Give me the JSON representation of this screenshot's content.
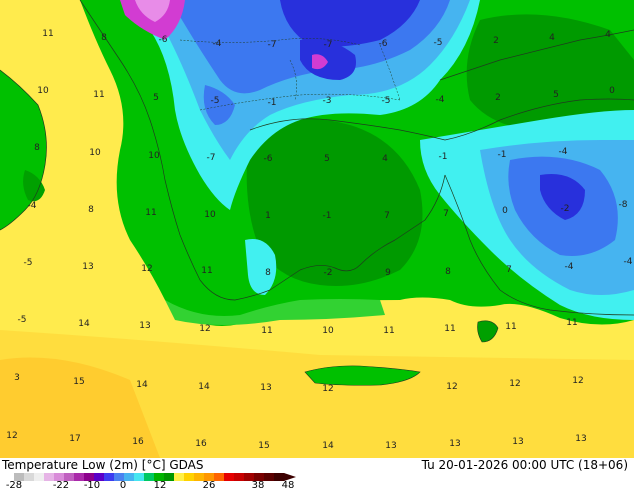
{
  "title": "Temperature Low (2m) [°C] GDAS",
  "valid_time": "Tu 20-01-2026 00:00 UTC (18+06)",
  "colorbar": {
    "ticks": [
      "-28",
      "-22",
      "-10",
      "0",
      "12",
      "26",
      "38",
      "48"
    ],
    "colors": [
      "#bcbcbc",
      "#d9d9d9",
      "#efefef",
      "#e6b4e6",
      "#d98cd9",
      "#c060c0",
      "#aa2aaa",
      "#8c008c",
      "#5a00c8",
      "#3c3cf0",
      "#4a82f0",
      "#46b4f0",
      "#46e6f0",
      "#00c864",
      "#00b400",
      "#009600",
      "#fff046",
      "#ffd200",
      "#ffb400",
      "#ff9600",
      "#ff6400",
      "#e60000",
      "#c80000",
      "#a00000",
      "#780000",
      "#5a0000",
      "#3c0000"
    ]
  },
  "colors": {
    "ocean_warm": "#ffeb4d",
    "ocean_warmer": "#ffd233",
    "green_dark": "#00a000",
    "green_mid": "#00c000",
    "green_light": "#32d232",
    "cyan": "#41f0f0",
    "sky": "#46b4f0",
    "blue": "#3c78f0",
    "dark_blue": "#2830dc",
    "magenta": "#d23cd2",
    "coast": "#1e3c1e"
  },
  "labels": [
    {
      "v": "11"
    },
    {
      "v": "8"
    },
    {
      "v": "-6"
    },
    {
      "v": "-4"
    },
    {
      "v": "-7"
    },
    {
      "v": "-7"
    },
    {
      "v": "-6"
    },
    {
      "v": "-5"
    },
    {
      "v": "2"
    },
    {
      "v": "4"
    },
    {
      "v": "4"
    },
    {
      "v": "10"
    },
    {
      "v": "11"
    },
    {
      "v": "5"
    },
    {
      "v": "-5"
    },
    {
      "v": "-1"
    },
    {
      "v": "-3"
    },
    {
      "v": "-5"
    },
    {
      "v": "-4"
    },
    {
      "v": "2"
    },
    {
      "v": "5"
    },
    {
      "v": "0"
    },
    {
      "v": "8"
    },
    {
      "v": "10"
    },
    {
      "v": "10"
    },
    {
      "v": "-7"
    },
    {
      "v": "-6"
    },
    {
      "v": "5"
    },
    {
      "v": "4"
    },
    {
      "v": "-1"
    },
    {
      "v": "-1"
    },
    {
      "v": "-4"
    },
    {
      "v": "-4"
    },
    {
      "v": "8"
    },
    {
      "v": "11"
    },
    {
      "v": "10"
    },
    {
      "v": "1"
    },
    {
      "v": "-1"
    },
    {
      "v": "7"
    },
    {
      "v": "7"
    },
    {
      "v": "0"
    },
    {
      "v": "-2"
    },
    {
      "v": "-8"
    },
    {
      "v": "-5"
    },
    {
      "v": "13"
    },
    {
      "v": "12"
    },
    {
      "v": "11"
    },
    {
      "v": "8"
    },
    {
      "v": "-2"
    },
    {
      "v": "9"
    },
    {
      "v": "8"
    },
    {
      "v": "7"
    },
    {
      "v": "-4"
    },
    {
      "v": "-4"
    },
    {
      "v": "-5"
    },
    {
      "v": "14"
    },
    {
      "v": "13"
    },
    {
      "v": "12"
    },
    {
      "v": "11"
    },
    {
      "v": "10"
    },
    {
      "v": "11"
    },
    {
      "v": "11"
    },
    {
      "v": "11"
    },
    {
      "v": "11"
    },
    {
      "v": "3"
    },
    {
      "v": "15"
    },
    {
      "v": "14"
    },
    {
      "v": "14"
    },
    {
      "v": "13"
    },
    {
      "v": "12"
    },
    {
      "v": "12"
    },
    {
      "v": "12"
    },
    {
      "v": "12"
    },
    {
      "v": "12"
    },
    {
      "v": "17"
    },
    {
      "v": "16"
    },
    {
      "v": "16"
    },
    {
      "v": "15"
    },
    {
      "v": "14"
    },
    {
      "v": "13"
    },
    {
      "v": "13"
    },
    {
      "v": "13"
    },
    {
      "v": "13"
    },
    {
      "v": "13"
    }
  ]
}
